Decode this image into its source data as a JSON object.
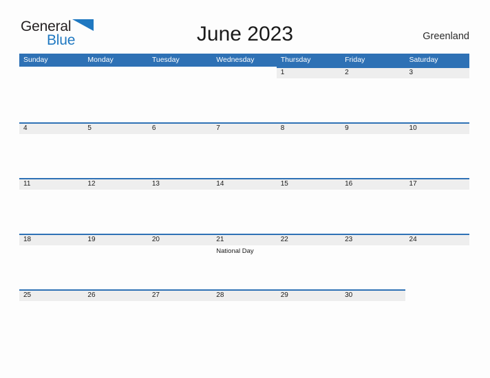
{
  "brand": {
    "logo_part1": "General",
    "logo_part2": "Blue",
    "logo_icon": "blue-flag-triangle",
    "color_blue": "#1f78c1"
  },
  "header": {
    "title": "June 2023",
    "country": "Greenland"
  },
  "theme": {
    "header_blue": "#2e71b5",
    "band_gray": "#eeeeee",
    "page_background": "#fdfdfd",
    "text_dark": "#1a1a1a"
  },
  "calendar": {
    "weekdays": [
      "Sunday",
      "Monday",
      "Tuesday",
      "Wednesday",
      "Thursday",
      "Friday",
      "Saturday"
    ],
    "weeks": [
      [
        {
          "day": "",
          "events": [],
          "state": "blank"
        },
        {
          "day": "",
          "events": [],
          "state": "blank"
        },
        {
          "day": "",
          "events": [],
          "state": "blank"
        },
        {
          "day": "",
          "events": [],
          "state": "blank"
        },
        {
          "day": "1",
          "events": [],
          "state": "day"
        },
        {
          "day": "2",
          "events": [],
          "state": "day"
        },
        {
          "day": "3",
          "events": [],
          "state": "day"
        }
      ],
      [
        {
          "day": "4",
          "events": [],
          "state": "day"
        },
        {
          "day": "5",
          "events": [],
          "state": "day"
        },
        {
          "day": "6",
          "events": [],
          "state": "day"
        },
        {
          "day": "7",
          "events": [],
          "state": "day"
        },
        {
          "day": "8",
          "events": [],
          "state": "day"
        },
        {
          "day": "9",
          "events": [],
          "state": "day"
        },
        {
          "day": "10",
          "events": [],
          "state": "day"
        }
      ],
      [
        {
          "day": "11",
          "events": [],
          "state": "day"
        },
        {
          "day": "12",
          "events": [],
          "state": "day"
        },
        {
          "day": "13",
          "events": [],
          "state": "day"
        },
        {
          "day": "14",
          "events": [],
          "state": "day"
        },
        {
          "day": "15",
          "events": [],
          "state": "day"
        },
        {
          "day": "16",
          "events": [],
          "state": "day"
        },
        {
          "day": "17",
          "events": [],
          "state": "day"
        }
      ],
      [
        {
          "day": "18",
          "events": [],
          "state": "day"
        },
        {
          "day": "19",
          "events": [],
          "state": "day"
        },
        {
          "day": "20",
          "events": [],
          "state": "day"
        },
        {
          "day": "21",
          "events": [
            "National Day"
          ],
          "state": "day"
        },
        {
          "day": "22",
          "events": [],
          "state": "day"
        },
        {
          "day": "23",
          "events": [],
          "state": "day"
        },
        {
          "day": "24",
          "events": [],
          "state": "day"
        }
      ],
      [
        {
          "day": "25",
          "events": [],
          "state": "day"
        },
        {
          "day": "26",
          "events": [],
          "state": "day"
        },
        {
          "day": "27",
          "events": [],
          "state": "day"
        },
        {
          "day": "28",
          "events": [],
          "state": "day"
        },
        {
          "day": "29",
          "events": [],
          "state": "day"
        },
        {
          "day": "30",
          "events": [],
          "state": "day"
        },
        {
          "day": "",
          "events": [],
          "state": "blank"
        }
      ]
    ]
  }
}
